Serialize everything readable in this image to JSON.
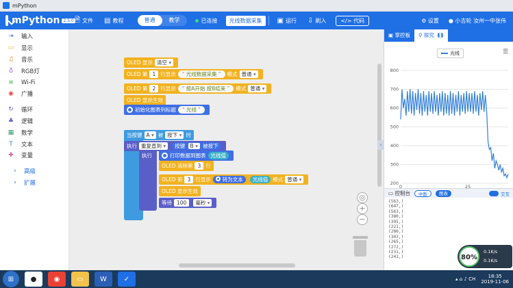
{
  "window": {
    "title": "mPython"
  },
  "header": {
    "brand": "mPython",
    "version": "2.5.0",
    "file": "文件",
    "tutorial": "教程",
    "modes": [
      "普通",
      "教学"
    ],
    "status": "已连接",
    "data_collect": "光线数据采集",
    "run": "运行",
    "flash": "刷入",
    "code": "代码",
    "settings": "设置",
    "user": "小吉轮 汝州一中张伟"
  },
  "sidebar": {
    "items": [
      {
        "label": "输入",
        "color": "#3b7be0"
      },
      {
        "label": "显示",
        "color": "#f0b21f"
      },
      {
        "label": "音乐",
        "color": "#ef7d2c"
      },
      {
        "label": "RGB灯",
        "color": "#a55bd0"
      },
      {
        "label": "Wi-Fi",
        "color": "#3cb54a"
      },
      {
        "label": "广播",
        "color": "#e04a4a"
      },
      {
        "label": "循环",
        "color": "#5a5fc7"
      },
      {
        "label": "逻辑",
        "color": "#5a5fc7"
      },
      {
        "label": "数学",
        "color": "#3a9c6a"
      },
      {
        "label": "文本",
        "color": "#3b7be0"
      },
      {
        "label": "变量",
        "color": "#d45a9a"
      }
    ],
    "advanced": [
      "高级",
      "扩展"
    ]
  },
  "blocks": {
    "b1": {
      "a": "OLED 显示",
      "b": "清空"
    },
    "b2": {
      "a": "OLED 第",
      "line": "1",
      "b": "行显示",
      "text": "光线数据采集",
      "mode": "模式",
      "mode_val": "普通"
    },
    "b3": {
      "a": "OLED 第",
      "line": "2",
      "b": "行显示",
      "text": "按A开始 按B结束",
      "mode": "模式",
      "mode_val": "普通"
    },
    "b4": {
      "a": "OLED 显示生效"
    },
    "b5": {
      "a": "初始化图表列标题",
      "text": "光线"
    },
    "e1": {
      "a": "当按键",
      "key": "A",
      "b": "被",
      "state": "按下",
      "c": "时"
    },
    "e2": {
      "a": "执行",
      "loop": "重复直到",
      "b": "按键",
      "key": "B",
      "c": "被按下"
    },
    "e3": {
      "a": "执行",
      "b": "打印数据到图表",
      "c": "光线值"
    },
    "e4": {
      "a": "OLED 清除第",
      "line": "3",
      "b": "行"
    },
    "e5": {
      "a": "OLED 第",
      "line": "3",
      "b": "行显示",
      "c": "转为文本",
      "d": "光线值",
      "mode": "模式",
      "mode_val": "普通"
    },
    "e6": {
      "a": "OLED 显示生效"
    },
    "e7": {
      "a": "等待",
      "val": "100",
      "unit": "毫秒"
    }
  },
  "rpanel": {
    "tab_board": "掌控板",
    "tab_probe": "探究",
    "console_title": "控制台",
    "btn_interrupt": "中断",
    "btn_chart": "图表",
    "toggle_label": "交互",
    "console_lines": [
      "(563,)",
      "(647,)",
      "(563,)",
      "(380,)",
      "(395,)",
      "(221,)",
      "(286,)",
      "(303,)",
      "(265,)",
      "(272,)",
      "(231,)",
      "(241,)"
    ]
  },
  "chart_data": {
    "type": "line",
    "title": "",
    "xlabel": "",
    "ylabel": "",
    "ylim": [
      200,
      800
    ],
    "xlim": [
      0,
      40
    ],
    "yticks": [
      200,
      300,
      400,
      500,
      600,
      700,
      800
    ],
    "xticks": [
      0,
      25
    ],
    "grid": true,
    "series": [
      {
        "name": "光线",
        "color": "#2f7ed8",
        "x": [
          0,
          0.5,
          1,
          1.5,
          2,
          2.5,
          3,
          3.5,
          4,
          4.5,
          5,
          5.5,
          6,
          6.5,
          7,
          7.5,
          8,
          8.5,
          9,
          9.5,
          10,
          10.5,
          11,
          11.5,
          12,
          12.5,
          13,
          13.5,
          14,
          14.5,
          15,
          15.5,
          16,
          16.5,
          17,
          17.5,
          18,
          18.5,
          19,
          19.5,
          20,
          20.5,
          21,
          21.5,
          22,
          22.5,
          23,
          23.5,
          24,
          24.5,
          25,
          25.5,
          26,
          26.5,
          27,
          27.5,
          28,
          28.5,
          29,
          29.5,
          30,
          30.5,
          31,
          31.5,
          32,
          32.5,
          33,
          33.5,
          34,
          34.5,
          35,
          35.5,
          36,
          36.5,
          37,
          37.5,
          38,
          38.5,
          39,
          39.5,
          40
        ],
        "values": [
          540,
          700,
          600,
          650,
          560,
          690,
          580,
          700,
          570,
          690,
          560,
          680,
          590,
          700,
          570,
          680,
          560,
          690,
          580,
          670,
          560,
          690,
          580,
          680,
          570,
          690,
          580,
          670,
          560,
          680,
          580,
          690,
          560,
          680,
          570,
          670,
          560,
          690,
          570,
          680,
          560,
          670,
          580,
          690,
          560,
          670,
          580,
          680,
          570,
          690,
          580,
          680,
          580,
          680,
          570,
          690,
          580,
          670,
          560,
          680,
          590,
          690,
          580,
          670,
          580,
          420,
          380,
          390,
          320,
          360,
          280,
          320,
          300,
          270,
          300,
          260,
          280,
          240,
          250,
          230,
          250
        ]
      }
    ]
  }
}
